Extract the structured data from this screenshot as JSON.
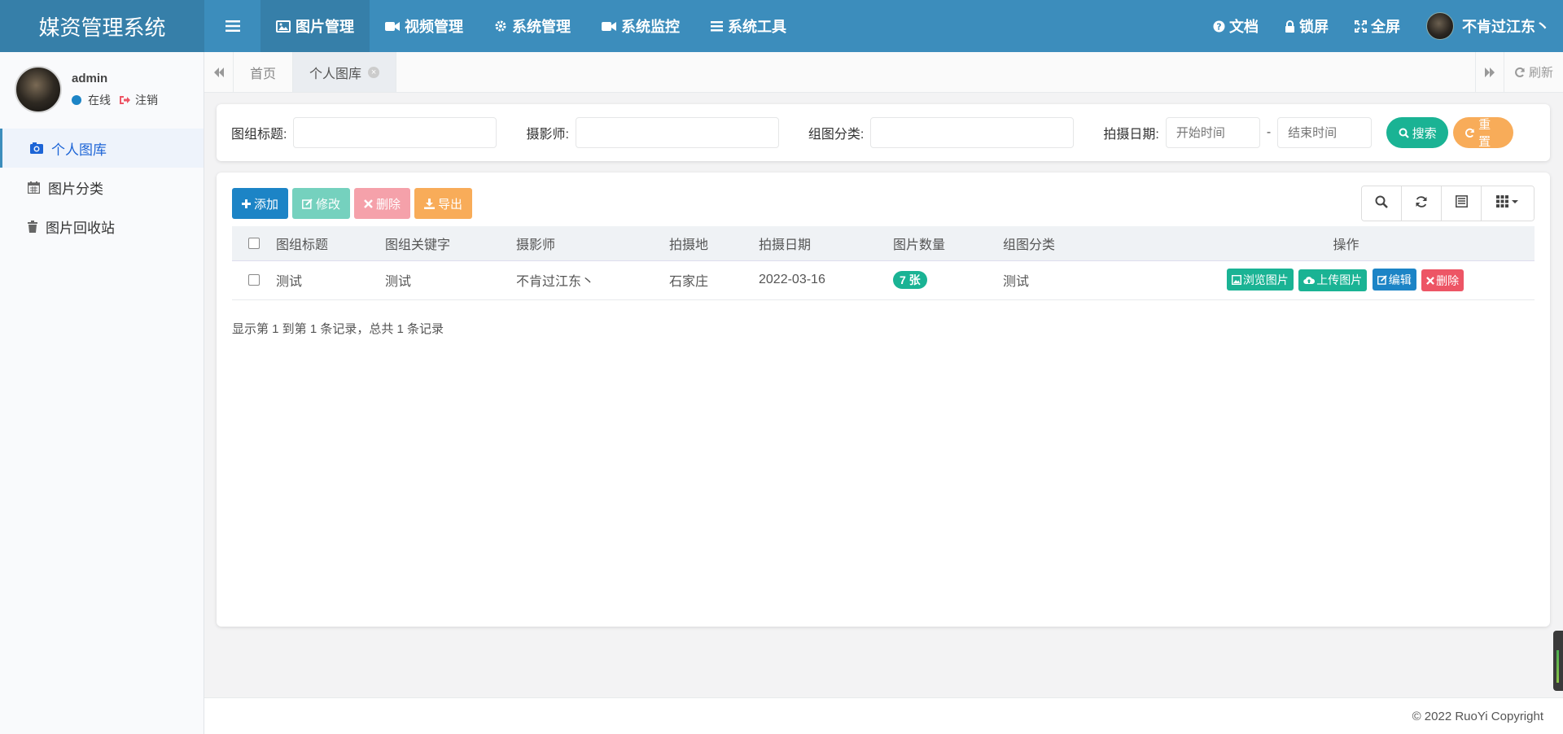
{
  "header": {
    "brand": "媒资管理系统",
    "nav": [
      {
        "label": "图片管理",
        "icon": "image-icon",
        "active": true
      },
      {
        "label": "视频管理",
        "icon": "video-icon",
        "active": false
      },
      {
        "label": "系统管理",
        "icon": "gear-icon",
        "active": false
      },
      {
        "label": "系统监控",
        "icon": "video-icon",
        "active": false
      },
      {
        "label": "系统工具",
        "icon": "list-icon",
        "active": false
      }
    ],
    "right": {
      "docs": "文档",
      "lock": "锁屏",
      "fullscreen": "全屏",
      "username": "不肯过江东丶"
    }
  },
  "sidebar": {
    "user": {
      "name": "admin",
      "status": "在线",
      "logout": "注销"
    },
    "menu": [
      {
        "label": "个人图库",
        "icon": "camera-icon",
        "active": true
      },
      {
        "label": "图片分类",
        "icon": "calendar-icon",
        "active": false
      },
      {
        "label": "图片回收站",
        "icon": "trash-icon",
        "active": false
      }
    ]
  },
  "tabs": {
    "items": [
      {
        "label": "首页",
        "active": false
      },
      {
        "label": "个人图库",
        "active": true
      }
    ],
    "refresh": "刷新"
  },
  "search": {
    "fields": [
      {
        "label": "图组标题:",
        "value": "",
        "placeholder": ""
      },
      {
        "label": "摄影师:",
        "value": "",
        "placeholder": ""
      },
      {
        "label": "组图分类:",
        "value": "",
        "placeholder": ""
      }
    ],
    "date_label": "拍摄日期:",
    "start_placeholder": "开始时间",
    "end_placeholder": "结束时间",
    "date_separator": "-",
    "search_btn": "搜索",
    "reset_btn": "重置"
  },
  "toolbar": {
    "add": "添加",
    "edit": "修改",
    "delete": "删除",
    "export": "导出"
  },
  "table": {
    "columns": [
      "图组标题",
      "图组关键字",
      "摄影师",
      "拍摄地",
      "拍摄日期",
      "图片数量",
      "组图分类",
      "操作"
    ],
    "rows": [
      {
        "title": "测试",
        "keywords": "测试",
        "photographer": "不肯过江东丶",
        "location": "石家庄",
        "date": "2022-03-16",
        "count": "7 张",
        "category": "测试",
        "actions": {
          "browse": "浏览图片",
          "upload": "上传图片",
          "edit": "编辑",
          "delete": "删除"
        }
      }
    ],
    "pagination_info": "显示第 1 到第 1 条记录，总共 1 条记录"
  },
  "footer": {
    "copyright": "© 2022 RuoYi Copyright"
  },
  "colors": {
    "header": "#3c8dbc",
    "brand_bg": "#367fa9",
    "primary": "#1c84c6",
    "success": "#1ab394",
    "danger": "#ed5565",
    "warning": "#f8ac59"
  }
}
